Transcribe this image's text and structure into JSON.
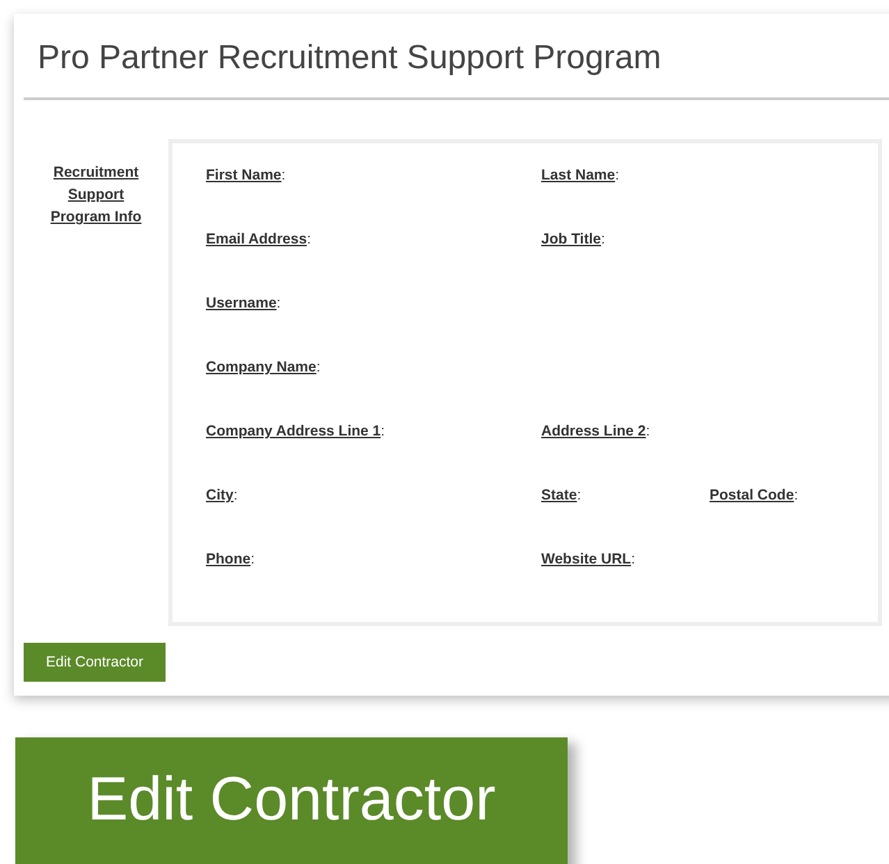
{
  "title": "Pro Partner Recruitment Support Program",
  "sidebar_link": "Recruitment Support Program Info",
  "field_rows": [
    [
      {
        "label": "First Name",
        "punct": ":"
      },
      {
        "label": "Last Name",
        "punct": ":"
      }
    ],
    [
      {
        "label": "Email Address",
        "punct": ":"
      },
      {
        "label": "Job Title",
        "punct": ":"
      }
    ],
    [
      {
        "label": "Username",
        "punct": ":"
      }
    ],
    [
      {
        "label": "Company Name",
        "punct": ":"
      }
    ],
    [
      {
        "label": "Company Address Line 1",
        "punct": ":"
      },
      {
        "label": "Address Line 2",
        "punct": ":"
      }
    ],
    [
      {
        "label": "City",
        "punct": ":"
      },
      {
        "label": "State",
        "punct": ":"
      },
      {
        "label": "Postal Code",
        "punct": ":"
      }
    ],
    [
      {
        "label": "Phone",
        "punct": ":"
      },
      {
        "label": "Website URL",
        "punct": ":"
      }
    ]
  ],
  "button": "Edit Contractor",
  "zoomed_button": "Edit Contractor"
}
